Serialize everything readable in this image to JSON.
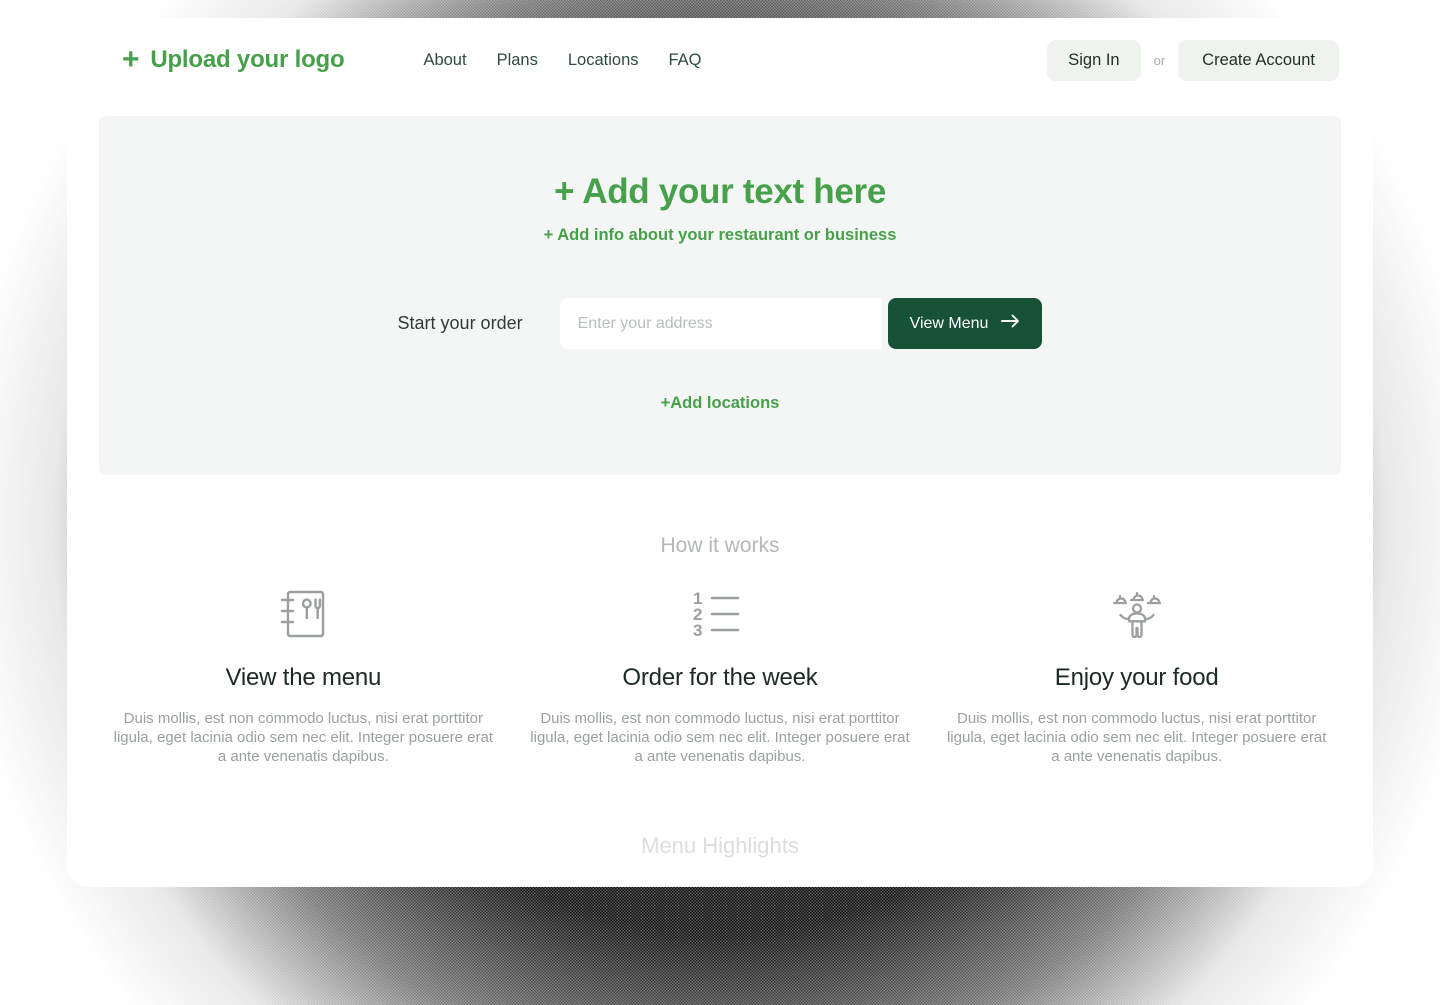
{
  "header": {
    "logo_plus": "+",
    "logo_text": "Upload your logo",
    "nav": [
      {
        "label": "About"
      },
      {
        "label": "Plans"
      },
      {
        "label": "Locations"
      },
      {
        "label": "FAQ"
      }
    ],
    "sign_in_label": "Sign In",
    "or_label": "or",
    "create_account_label": "Create Account"
  },
  "hero": {
    "title": "+ Add your text here",
    "subtitle": "+ Add info about your restaurant or business",
    "order_label": "Start your order",
    "address_placeholder": "Enter your address",
    "address_value": "",
    "view_menu_label": "View Menu",
    "add_locations_label": "+Add locations"
  },
  "how_it_works": {
    "heading": "How it works",
    "features": [
      {
        "icon": "menu-book-icon",
        "title": "View the menu",
        "text": "Duis mollis, est non commodo luctus, nisi erat porttitor ligula, eget lacinia odio sem nec elit. Integer posuere erat a ante venenatis dapibus."
      },
      {
        "icon": "numbered-list-icon",
        "title": "Order for the week",
        "text": "Duis mollis, est non commodo luctus, nisi erat porttitor ligula, eget lacinia odio sem nec elit. Integer posuere erat a ante venenatis dapibus."
      },
      {
        "icon": "waiter-serving-icon",
        "title": "Enjoy your food",
        "text": "Duis mollis, est non commodo luctus, nisi erat porttitor ligula, eget lacinia odio sem nec elit. Integer posuere erat a ante venenatis dapibus."
      }
    ]
  },
  "menu_highlights": {
    "heading": "Menu Highlights"
  },
  "colors": {
    "brand_green": "#47a04a",
    "dark_green": "#175136",
    "nav_text": "#2e4a3d",
    "hero_bg": "#f4f6f5",
    "button_bg": "#eef3ee",
    "muted_text": "#9aa19d",
    "section_heading": "#b3b8b6"
  }
}
